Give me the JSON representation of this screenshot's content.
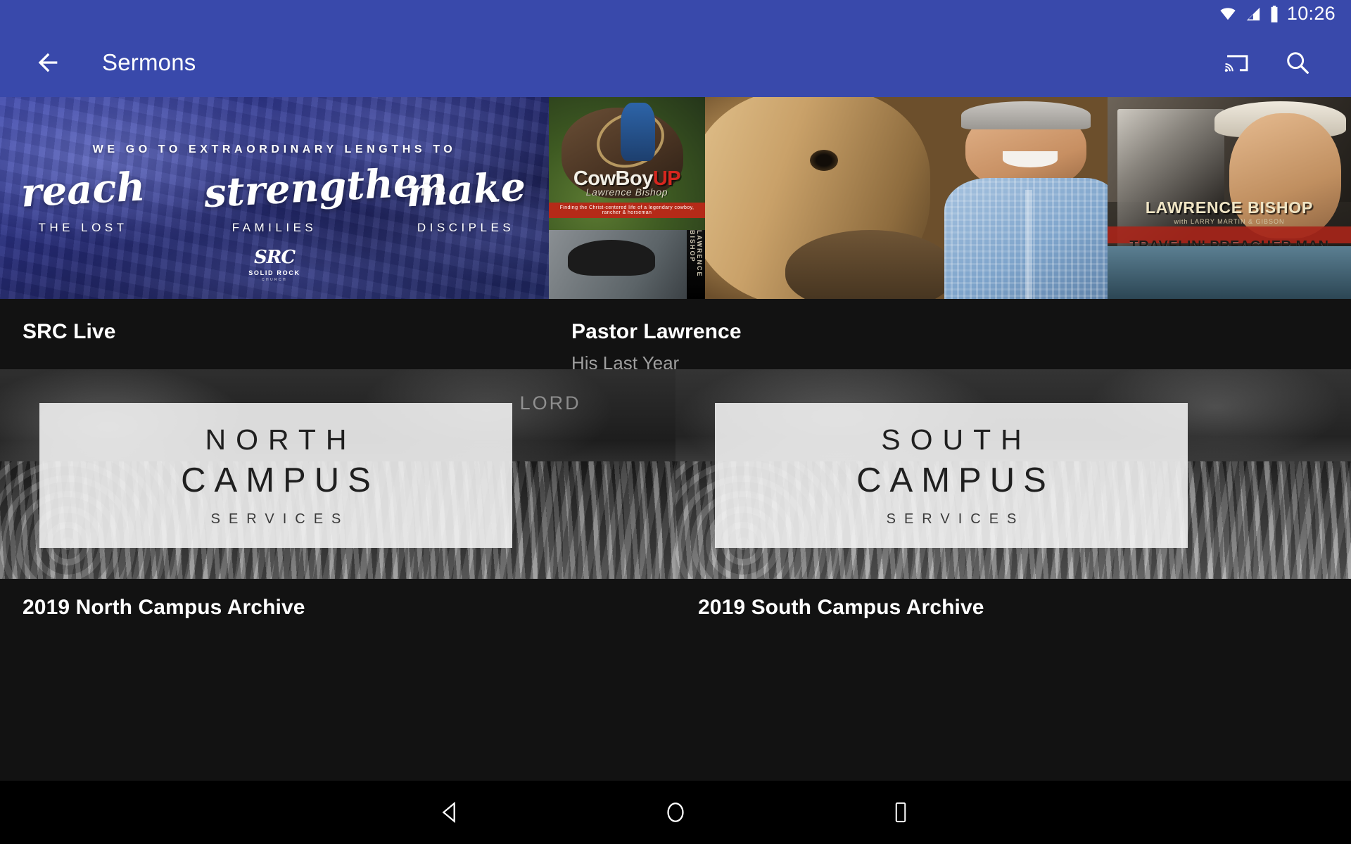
{
  "status_bar": {
    "time": "10:26",
    "icons": [
      "wifi-icon",
      "cellular-signal-icon",
      "battery-icon"
    ]
  },
  "app_bar": {
    "back_icon": "back-arrow-icon",
    "title": "Sermons",
    "cast_icon": "chromecast-icon",
    "search_icon": "search-icon"
  },
  "theme": {
    "accent": "#3949ab",
    "background": "#121212",
    "title_color": "#ffffff",
    "subtitle_color": "#9e9e9e"
  },
  "cards": [
    {
      "title": "SRC Live",
      "subtitle": "",
      "artwork": {
        "kicker": "WE GO TO EXTRAORDINARY LENGTHS TO",
        "phrases": [
          {
            "script": "reach",
            "caps": "THE LOST"
          },
          {
            "script": "strengthen",
            "caps": "FAMILIES"
          },
          {
            "script": "make",
            "caps": "DISCIPLES"
          }
        ],
        "logo_mark": "SRC",
        "logo_name": "SOLID ROCK",
        "logo_sub": "CHURCH"
      }
    },
    {
      "title": "Pastor Lawrence",
      "subtitle": "His Last Year",
      "artwork": {
        "book_title_main": "CowBoy",
        "book_title_accent": "UP",
        "book_author": "Lawrence Bishop",
        "book_band": "Finding the Christ-centered life of a legendary cowboy, rancher & horseman",
        "book_spine": "LAWRENCE BISHOP",
        "album_artist": "LAWRENCE BISHOP",
        "album_credit": "with LARRY MARTIN & GIBSON",
        "album_tagline": "TRAVELIN' PREACHER MAN"
      }
    },
    {
      "title": "2019 North Campus Archive",
      "subtitle": "",
      "artwork": {
        "plate_line1": "NORTH",
        "plate_line2": "CAMPUS",
        "plate_line3": "SERVICES",
        "banner_text": "LORD"
      }
    },
    {
      "title": "2019 South Campus Archive",
      "subtitle": "",
      "artwork": {
        "plate_line1": "SOUTH",
        "plate_line2": "CAMPUS",
        "plate_line3": "SERVICES",
        "banner_text": ""
      }
    }
  ],
  "nav_bar": {
    "back_icon": "triangle-back-icon",
    "home_icon": "circle-home-icon",
    "recents_icon": "square-recents-icon"
  }
}
